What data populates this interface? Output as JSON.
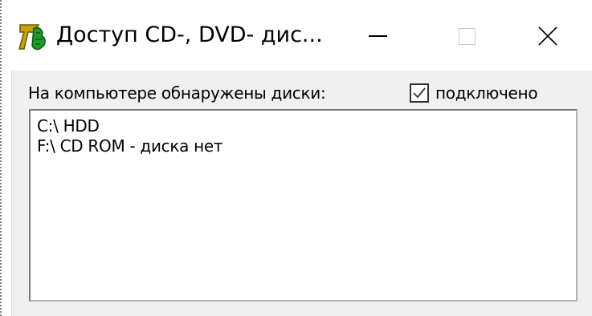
{
  "window": {
    "title": "Доступ CD-, DVD- дис...",
    "icon": "app-icon",
    "controls": {
      "minimize": "minimize-icon",
      "maximize": "maximize-icon",
      "close": "close-icon"
    }
  },
  "content": {
    "label": "На компьютере обнаружены диски:",
    "checkbox": {
      "label": "подключено",
      "checked": true
    },
    "drives": [
      "C:\\ HDD",
      "F:\\ CD ROM - диска нет"
    ]
  }
}
